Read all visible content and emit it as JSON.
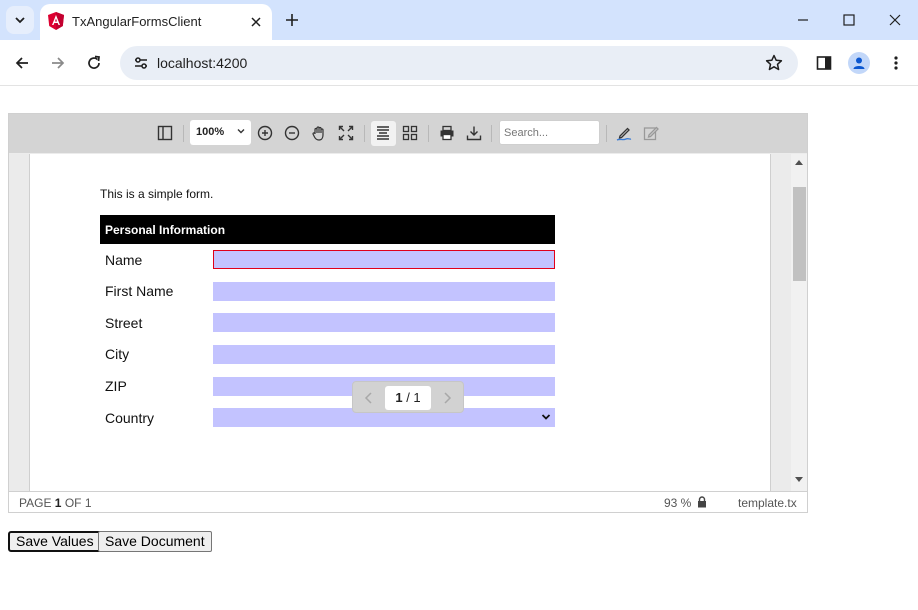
{
  "browser": {
    "tab_title": "TxAngularFormsClient",
    "url": "localhost:4200"
  },
  "viewer": {
    "zoom_value": "100%",
    "search_placeholder": "Search...",
    "document": {
      "intro_text": "This is a simple form.",
      "section_title": "Personal Information",
      "fields": [
        {
          "label": "Name",
          "value": "",
          "focused": true
        },
        {
          "label": "First Name",
          "value": ""
        },
        {
          "label": "Street",
          "value": ""
        },
        {
          "label": "City",
          "value": ""
        },
        {
          "label": "ZIP",
          "value": ""
        },
        {
          "label": "Country",
          "value": "",
          "type": "dropdown"
        }
      ],
      "field_color": "#c3c3ff"
    },
    "pager": {
      "current": "1",
      "separator": " / ",
      "total": "1"
    },
    "status": {
      "page_prefix": "PAGE ",
      "page_current": "1",
      "page_suffix": " OF 1",
      "zoom": "93 %",
      "filename": "template.tx"
    }
  },
  "actions": {
    "save_values": "Save Values",
    "save_document": "Save Document"
  }
}
